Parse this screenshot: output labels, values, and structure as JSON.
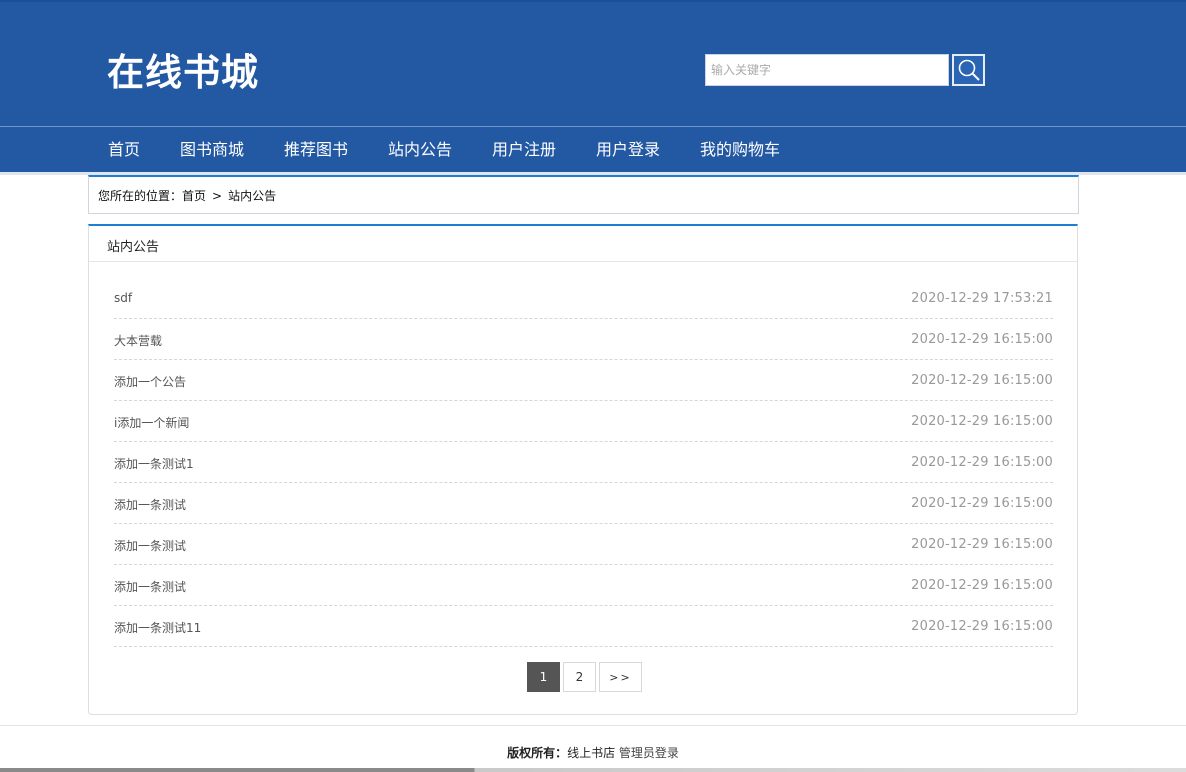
{
  "header": {
    "logo": "在线书城",
    "search_placeholder": "输入关键字",
    "search_icon": "search-icon"
  },
  "nav": {
    "items": [
      {
        "label": "首页"
      },
      {
        "label": "图书商城"
      },
      {
        "label": "推荐图书"
      },
      {
        "label": "站内公告"
      },
      {
        "label": "用户注册"
      },
      {
        "label": "用户登录"
      },
      {
        "label": "我的购物车"
      }
    ]
  },
  "breadcrumb": {
    "prefix": "您所在的位置：",
    "home": "首页",
    "separator": ">",
    "current": "站内公告"
  },
  "panel": {
    "title": "站内公告",
    "items": [
      {
        "title": "sdf",
        "date": "2020-12-29 17:53:21"
      },
      {
        "title": "大本营载",
        "date": "2020-12-29 16:15:00"
      },
      {
        "title": "添加一个公告",
        "date": "2020-12-29 16:15:00"
      },
      {
        "title": "i添加一个新闻",
        "date": "2020-12-29 16:15:00"
      },
      {
        "title": "添加一条测试1",
        "date": "2020-12-29 16:15:00"
      },
      {
        "title": "添加一条测试",
        "date": "2020-12-29 16:15:00"
      },
      {
        "title": "添加一条测试",
        "date": "2020-12-29 16:15:00"
      },
      {
        "title": "添加一条测试",
        "date": "2020-12-29 16:15:00"
      },
      {
        "title": "添加一条测试11",
        "date": "2020-12-29 16:15:00"
      }
    ]
  },
  "pagination": {
    "pages": [
      "1",
      "2"
    ],
    "current": "1",
    "next_label": ">>"
  },
  "footer": {
    "copyright_label": "版权所有：",
    "site_name": "线上书店",
    "admin_link": "管理员登录"
  },
  "colors": {
    "header_bg": "#2358a3",
    "accent_line": "#1e7fd0",
    "active_page_bg": "#555555"
  }
}
